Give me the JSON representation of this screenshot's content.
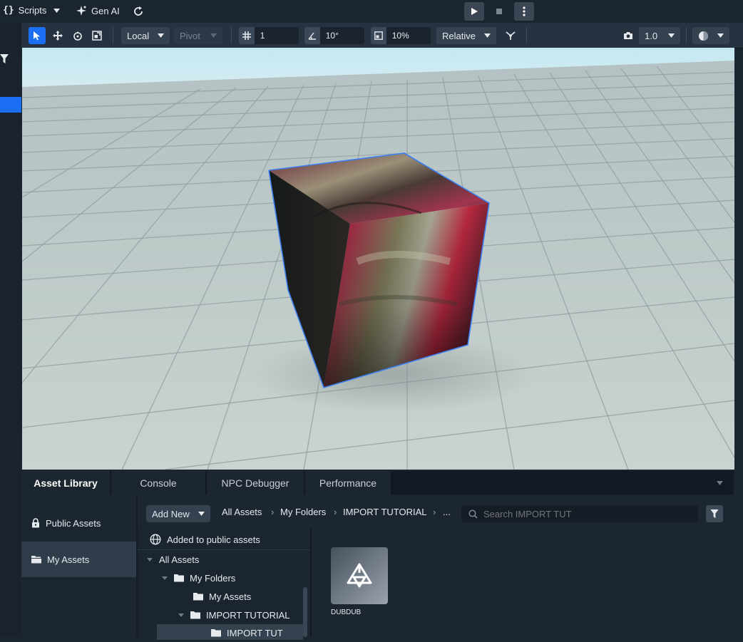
{
  "topbar": {
    "scripts_label": "Scripts",
    "genai_label": "Gen AI"
  },
  "toolbar": {
    "space_mode": "Local",
    "pivot_mode": "Pivot",
    "grid_snap": "1",
    "angle_snap": "10°",
    "scale_snap": "10%",
    "snap_mode": "Relative",
    "camera_speed": "1.0"
  },
  "bottom_tabs": [
    "Asset Library",
    "Console",
    "NPC Debugger",
    "Performance"
  ],
  "side_nav": {
    "public": "Public Assets",
    "mine": "My Assets"
  },
  "asset_bar": {
    "add_new": "Add New",
    "breadcrumb": [
      "All Assets",
      "My Folders",
      "IMPORT TUTORIAL",
      "..."
    ],
    "search_placeholder": "Search IMPORT TUT"
  },
  "tree": {
    "public_notice": "Added to public assets",
    "items": [
      "All Assets",
      "My Folders",
      "My Assets",
      "IMPORT TUTORIAL",
      "IMPORT TUT"
    ]
  },
  "assets": [
    {
      "name": "DUBDUB"
    }
  ],
  "colors": {
    "accent": "#1a6ff2",
    "panel": "#1c2631",
    "toolbar": "#26323f"
  }
}
